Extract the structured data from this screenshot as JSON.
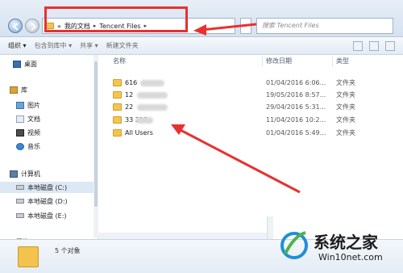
{
  "address": {
    "prefix": "«",
    "crumbs": [
      "我的文档",
      "Tencent Files"
    ],
    "separator": "▸",
    "search_placeholder": "搜索 Tencent Files"
  },
  "toolbar": {
    "organize": "组织 ▾",
    "include": "包含到库中 ▾",
    "share": "共享 ▾",
    "new_folder": "新建文件夹"
  },
  "sidebar": {
    "desktop": "桌面",
    "libraries": "库",
    "pictures": "图片",
    "documents": "文档",
    "videos": "视频",
    "music": "音乐",
    "computer": "计算机",
    "drive_c": "本地磁盘 (C:)",
    "drive_d": "本地磁盘 (D:)",
    "drive_e": "本地磁盘 (E:)",
    "network": "网络"
  },
  "columns": {
    "name": "名称",
    "date": "修改日期",
    "type": "类型"
  },
  "files": [
    {
      "name": "616",
      "date": "01/04/2016 6:06...",
      "type": "文件夹"
    },
    {
      "name": "12",
      "date": "19/05/2016 8:57...",
      "type": "文件夹"
    },
    {
      "name": "22",
      "date": "29/04/2016 5:31...",
      "type": "文件夹"
    },
    {
      "name": "33 218",
      "date": "11/04/2016 10:2...",
      "type": "文件夹"
    },
    {
      "name": "All Users",
      "date": "01/04/2016 5:49...",
      "type": "文件夹"
    }
  ],
  "status": {
    "count": "5 个对象"
  },
  "watermark": {
    "title": "系统之家",
    "site": "Win10net.com"
  },
  "colors": {
    "highlight": "#e8312f",
    "folder": "#f2c34d"
  }
}
